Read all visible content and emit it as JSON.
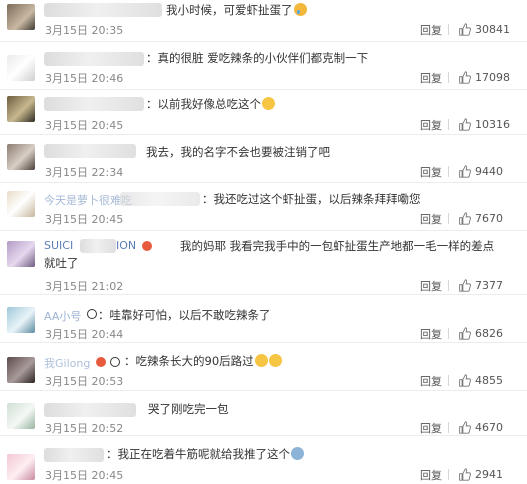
{
  "reply_label": "回复",
  "comments": [
    {
      "name": "",
      "text": "我小时候，可爱虾扯蛋了",
      "emoji": "crying-face",
      "time": "3月15日 20:35",
      "likes": "30841"
    },
    {
      "name": "",
      "text": "：真的很脏 爱吃辣条的小伙伴们都克制一下",
      "time": "3月15日 20:46",
      "likes": "17098"
    },
    {
      "name": "",
      "text": "：以前我好像总吃这个",
      "emoji": "sweat-face",
      "time": "3月15日 20:45",
      "likes": "10316"
    },
    {
      "name": "",
      "text": "我去，我的名字不会也要被注销了吧",
      "time": "3月15日 22:34",
      "likes": "9440"
    },
    {
      "name": "今天是萝卜很难吃",
      "text": "：我还吃过这个虾扯蛋，以后辣条拜拜嘞您",
      "time": "3月15日 20:45",
      "likes": "7670"
    },
    {
      "name": "SUICI",
      "name_tail": "ION",
      "text": "我的妈耶 我看完我手中的一包虾扯蛋生产地都一毛一样的差点就吐了",
      "time": "3月15日 21:02",
      "likes": "7377"
    },
    {
      "name": "AA小号",
      "text": "：哇靠好可怕，以后不敢吃辣条了",
      "time": "3月15日 20:44",
      "likes": "6826"
    },
    {
      "name": "我Gilong",
      "text": "：吃辣条长大的90后路过",
      "emoji": "laughing-face",
      "time": "3月15日 20:53",
      "likes": "4855"
    },
    {
      "name": "",
      "text": "哭了刚吃完一包",
      "time": "3月15日 20:52",
      "likes": "4670"
    },
    {
      "name": "",
      "text": "：我正在吃着牛筋呢就给我推了这个",
      "emoji": "shocked-face",
      "time": "3月15日 20:45",
      "likes": "2941"
    }
  ],
  "colors": {
    "name_link": "#5a7fb5",
    "text": "#333333",
    "meta": "#888888",
    "divider": "#ececec"
  },
  "icons": {
    "like": "thumbs-up-icon"
  }
}
